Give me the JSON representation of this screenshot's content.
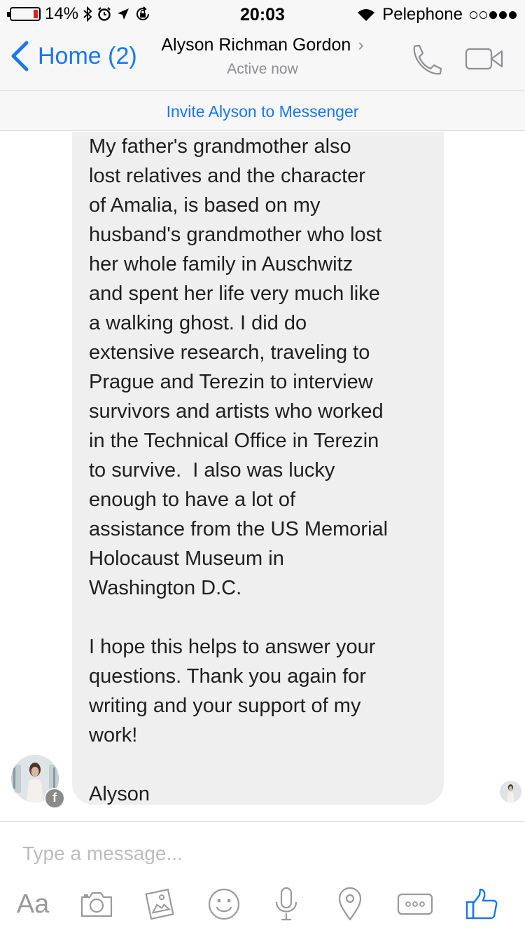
{
  "status_bar": {
    "battery": "14%",
    "battery_level": 0.14,
    "time": "20:03",
    "carrier": "Pelephone",
    "signal_bars": 3,
    "signal_total": 5
  },
  "header": {
    "back_label": "Home (2)",
    "contact_name": "Alyson Richman Gordon",
    "status": "Active now"
  },
  "invite_banner": "Invite Alyson to Messenger",
  "message": {
    "lines": [
      "My father's grandmother also",
      "lost relatives and the character",
      "of Amalia, is based on my",
      "husband's grandmother who lost",
      "her whole family in Auschwitz",
      "and spent her life very much like",
      "a walking ghost. I did do",
      "extensive research, traveling to",
      "Prague and Terezin to interview",
      "survivors and artists who worked",
      "in the Technical Office in Terezin",
      "to survive.  I also was lucky",
      "enough to have a lot of",
      "assistance from the US Memorial",
      "Holocaust Museum in",
      "Washington D.C.",
      "",
      "I hope this helps to answer your",
      "questions. Thank you again for",
      "writing and your support of my",
      "work!",
      "",
      "Alyson"
    ]
  },
  "composer": {
    "placeholder": "Type a message...",
    "aa_label": "Aa"
  },
  "colors": {
    "accent": "#1877f2",
    "bubble": "#efefef",
    "bar": "#f7f7f7",
    "battery_low": "#e0201c"
  },
  "icons": [
    "bluetooth-icon",
    "alarm-icon",
    "location-arrow-icon",
    "orientation-lock-icon",
    "wifi-icon",
    "back-chevron-icon",
    "phone-icon",
    "video-camera-icon",
    "camera-icon",
    "photo-gallery-icon",
    "emoji-icon",
    "microphone-icon",
    "location-pin-icon",
    "more-icon",
    "thumbs-up-icon"
  ]
}
